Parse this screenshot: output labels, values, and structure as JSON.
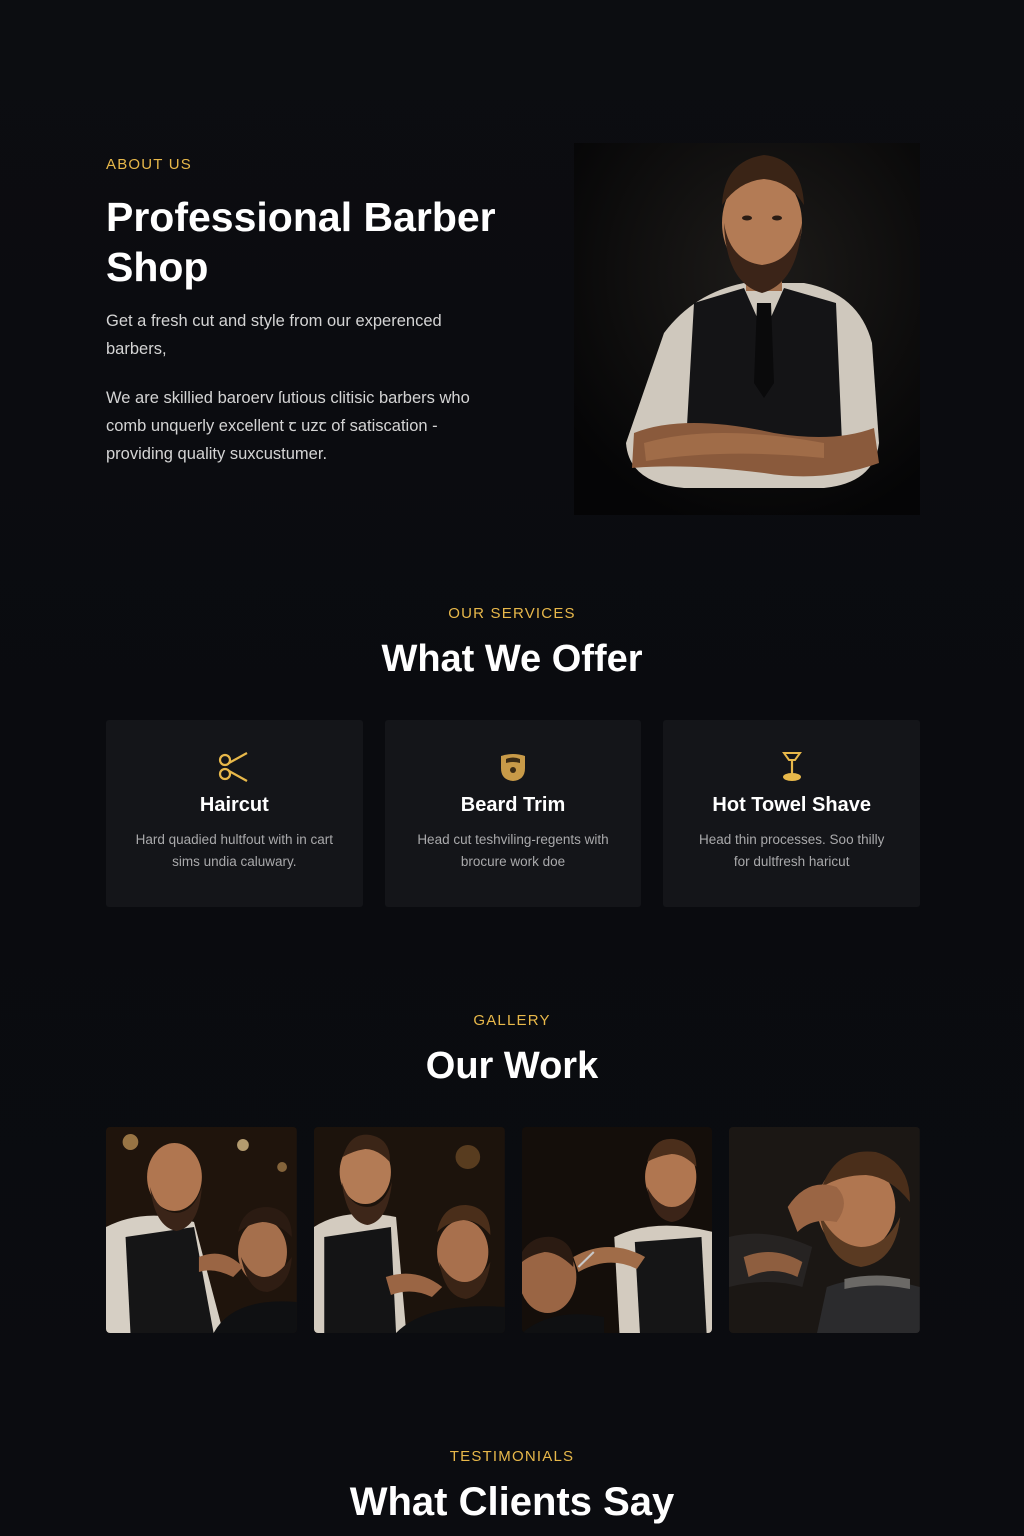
{
  "about": {
    "eyebrow": "ABOUT US",
    "title": "Professional Barber Shop",
    "paragraph1": "Get a fresh cut and style from our experenced barbers,",
    "paragraph2": "We are skillied baroerv ſutious clitisic barbers who comb unquerly excellent ꞇ uzꞇ of satiscation - providing quality suxcustumer."
  },
  "services": {
    "eyebrow": "OUR SERVICES",
    "title": "What We Offer",
    "items": [
      {
        "icon": "scissors-icon",
        "title": "Haircut",
        "text": "Hard quadied hultfout  with in cart sims undia caluwary."
      },
      {
        "icon": "beard-icon",
        "title": "Beard Trim",
        "text": "Head cut teshviling-regents with brocure work doe"
      },
      {
        "icon": "razor-icon",
        "title": "Hot Towel Shave",
        "text": "Head thin processes. Soo thilly for dultfresh haricut"
      }
    ]
  },
  "gallery": {
    "eyebrow": "GALLERY",
    "title": "Our Work",
    "images": [
      "gallery-photo-1",
      "gallery-photo-2",
      "gallery-photo-3",
      "gallery-photo-4"
    ]
  },
  "testimonials": {
    "eyebrow": "TESTIMONIALS",
    "title": "What Clients Say"
  },
  "colors": {
    "accent": "#e8b84a",
    "background": "#0b0c10",
    "card": "#141519",
    "text": "#ffffff",
    "muted": "#a9a9ab"
  }
}
